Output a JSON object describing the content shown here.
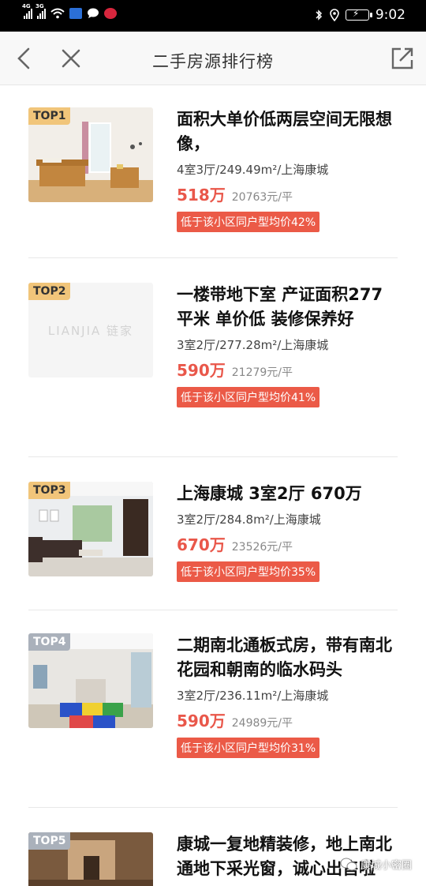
{
  "status_bar": {
    "network_1": "4G",
    "network_2": "3G",
    "time": "9:02"
  },
  "nav": {
    "title": "二手房源排行榜",
    "icons": [
      "back-arrow-icon",
      "close-icon",
      "share-icon"
    ]
  },
  "listings": [
    {
      "rank": "TOP1",
      "title": "面积大单价低两层空间无限想像，",
      "spec": "4室3厅/249.49m²/上海康城",
      "price": "518万",
      "unit_price": "20763元/平",
      "tag": "低于该小区同户型均价42%"
    },
    {
      "rank": "TOP2",
      "title": "一楼带地下室 产证面积277平米 单价低 装修保养好",
      "spec": "3室2厅/277.28m²/上海康城",
      "price": "590万",
      "unit_price": "21279元/平",
      "tag": "低于该小区同户型均价41%",
      "placeholder_logo": "LIANJIA 链家"
    },
    {
      "rank": "TOP3",
      "title": "上海康城 3室2厅 670万",
      "spec": "3室2厅/284.8m²/上海康城",
      "price": "670万",
      "unit_price": "23526元/平",
      "tag": "低于该小区同户型均价35%"
    },
    {
      "rank": "TOP4",
      "title": "二期南北通板式房，带有南北花园和朝南的临水码头",
      "spec": "3室2厅/236.11m²/上海康城",
      "price": "590万",
      "unit_price": "24989元/平",
      "tag": "低于该小区同户型均价31%"
    },
    {
      "rank": "TOP5",
      "title": "康城一复地精装修，地上南北通地下采光窗，诚心出售啦"
    }
  ],
  "watermark": "康城小密圈"
}
